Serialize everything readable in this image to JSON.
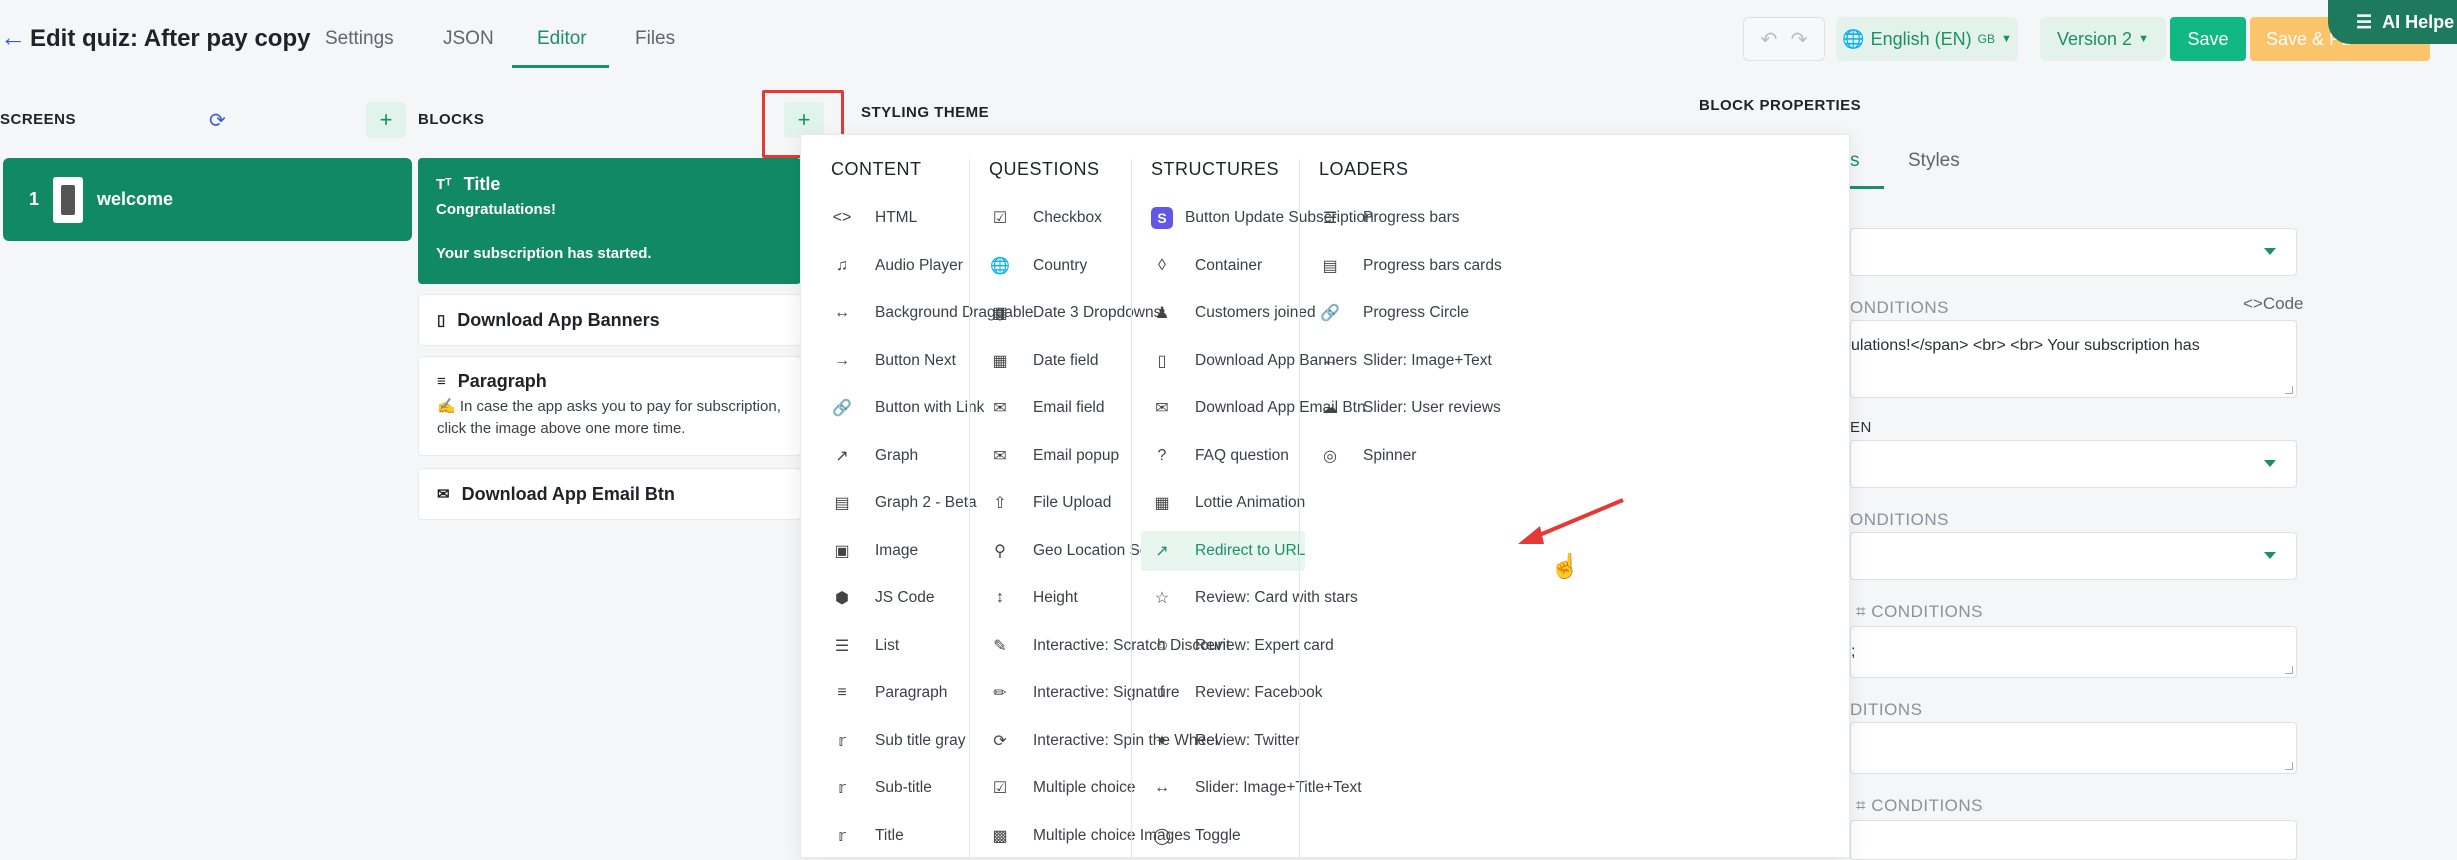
{
  "header": {
    "back_icon": "arrow-left-icon",
    "title": "Edit quiz: After pay copy",
    "tabs": [
      {
        "label": "Settings",
        "active": false
      },
      {
        "label": "JSON",
        "active": false
      },
      {
        "label": "Editor",
        "active": true
      },
      {
        "label": "Files",
        "active": false
      }
    ],
    "undo_icon": "undo-icon",
    "redo_icon": "redo-icon",
    "language": "English (EN)",
    "language_flag": "GB",
    "version": "Version 2",
    "save_label": "Save",
    "save_publish_label": "Save & Pu",
    "ai_help_label": "AI Helpe",
    "accent": "#10b981",
    "publish_color": "#fcc46a"
  },
  "screens": {
    "heading": "SCREENS",
    "items": [
      {
        "number": "1",
        "name": "welcome"
      }
    ]
  },
  "blocks": {
    "heading": "BLOCKS",
    "items": [
      {
        "title": "Title",
        "icon": "text-size-icon",
        "lines": [
          "Congratulations!",
          "",
          "Your subscription has started."
        ],
        "selected": true
      },
      {
        "title": "Download App Banners",
        "icon": "phone-icon",
        "lines": [],
        "selected": false
      },
      {
        "title": "Paragraph",
        "icon": "paragraph-icon",
        "lines": [
          "✍️ In case the app asks you to pay for subscription,",
          "click the image above one more time."
        ],
        "selected": false
      },
      {
        "title": "Download App Email Btn",
        "icon": "email-btn-icon",
        "lines": [],
        "selected": false
      }
    ]
  },
  "styling_theme": "STYLING THEME",
  "add_block_menu": {
    "columns": [
      {
        "heading": "CONTENT",
        "items": [
          {
            "label": "HTML",
            "icon": "code-icon"
          },
          {
            "label": "Audio Player",
            "icon": "music-note-icon"
          },
          {
            "label": "Background Draggable",
            "icon": "arrows-horizontal-icon"
          },
          {
            "label": "Button Next",
            "icon": "arrow-right-icon"
          },
          {
            "label": "Button with Link",
            "icon": "link-icon"
          },
          {
            "label": "Graph",
            "icon": "line-chart-icon"
          },
          {
            "label": "Graph 2 - Beta",
            "icon": "bar-chart-icon"
          },
          {
            "label": "Image",
            "icon": "image-icon"
          },
          {
            "label": "JS Code",
            "icon": "hexagon-code-icon"
          },
          {
            "label": "List",
            "icon": "list-icon"
          },
          {
            "label": "Paragraph",
            "icon": "paragraph-icon"
          },
          {
            "label": "Sub title gray",
            "icon": "text-size-icon"
          },
          {
            "label": "Sub-title",
            "icon": "text-size-icon"
          },
          {
            "label": "Title",
            "icon": "text-size-icon"
          }
        ]
      },
      {
        "heading": "QUESTIONS",
        "items": [
          {
            "label": "Checkbox",
            "icon": "checkbox-icon"
          },
          {
            "label": "Country",
            "icon": "globe-icon"
          },
          {
            "label": "Date 3 Dropdowns",
            "icon": "calendar-icon"
          },
          {
            "label": "Date field",
            "icon": "calendar-icon"
          },
          {
            "label": "Email field",
            "icon": "mail-icon"
          },
          {
            "label": "Email popup",
            "icon": "mail-icon"
          },
          {
            "label": "File Upload",
            "icon": "upload-icon"
          },
          {
            "label": "Geo Location Select",
            "icon": "location-pin-icon"
          },
          {
            "label": "Height",
            "icon": "arrows-vertical-icon"
          },
          {
            "label": "Interactive: Scratch Discount",
            "icon": "brush-icon"
          },
          {
            "label": "Interactive: Signature",
            "icon": "pen-icon"
          },
          {
            "label": "Interactive: Spin the Wheel",
            "icon": "wheel-icon"
          },
          {
            "label": "Multiple choice",
            "icon": "checkbox-icon"
          },
          {
            "label": "Multiple choice Images",
            "icon": "image-check-icon"
          }
        ]
      },
      {
        "heading": "STRUCTURES",
        "items": [
          {
            "label": "Button Update Subscription",
            "icon": "stripe-s-icon"
          },
          {
            "label": "Container",
            "icon": "layers-icon"
          },
          {
            "label": "Customers joined",
            "icon": "users-icon"
          },
          {
            "label": "Download App Banners",
            "icon": "phone-icon"
          },
          {
            "label": "Download App Email Btn",
            "icon": "email-btn-icon"
          },
          {
            "label": "FAQ question",
            "icon": "question-circle-icon"
          },
          {
            "label": "Lottie Animation",
            "icon": "film-icon"
          },
          {
            "label": "Redirect to URL",
            "icon": "external-link-icon",
            "highlighted": true
          },
          {
            "label": "Review: Card with stars",
            "icon": "star-icon"
          },
          {
            "label": "Review: Expert card",
            "icon": "user-circle-icon"
          },
          {
            "label": "Review: Facebook",
            "icon": "facebook-icon"
          },
          {
            "label": "Review: Twitter",
            "icon": "twitter-icon"
          },
          {
            "label": "Slider: Image+Title+Text",
            "icon": "arrows-horizontal-icon"
          },
          {
            "label": "Toggle",
            "icon": "toggle-icon"
          }
        ]
      },
      {
        "heading": "LOADERS",
        "items": [
          {
            "label": "Progress bars",
            "icon": "bars-icon"
          },
          {
            "label": "Progress bars cards",
            "icon": "bar-chart-icon"
          },
          {
            "label": "Progress Circle",
            "icon": "link-icon"
          },
          {
            "label": "Slider: Image+Text",
            "icon": "arrows-horizontal-icon"
          },
          {
            "label": "Slider: User reviews",
            "icon": "reviews-icon"
          },
          {
            "label": "Spinner",
            "icon": "spinner-icon"
          }
        ]
      }
    ]
  },
  "block_properties": {
    "heading": "BLOCK PROPERTIES",
    "tab_partial": "s",
    "tab_styles": "Styles",
    "conditions_partial_1": "ONDITIONS",
    "code_link": "<>Code",
    "textarea_value": "ulations!</span> <br> <br> Your subscription has",
    "label_en": "EN",
    "conditions_partial_2": "ONDITIONS",
    "conditions_label_3": "⌗ CONDITIONS",
    "textarea_value_2": ";",
    "conditions_partial_4": "DITIONS",
    "conditions_label_5": "⌗ CONDITIONS"
  }
}
